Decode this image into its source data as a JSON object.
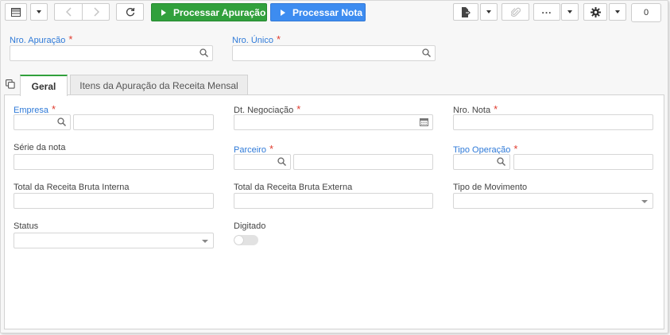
{
  "toolbar": {
    "process_apuracao_label": "Processar Apuração",
    "process_nota_label": "Processar Nota",
    "counter": "0",
    "colors": {
      "green": "#31a03c",
      "blue": "#3d8cf0"
    }
  },
  "header_fields": {
    "nro_apuracao": {
      "label": "Nro. Apuração",
      "required": "*",
      "value": ""
    },
    "nro_unico": {
      "label": "Nro. Único",
      "required": "*",
      "value": ""
    }
  },
  "tabs": [
    {
      "label": "Geral",
      "active": true
    },
    {
      "label": "Itens da Apuração da Receita Mensal",
      "active": false
    }
  ],
  "form": {
    "empresa": {
      "label": "Empresa",
      "required": "*"
    },
    "dt_negociacao": {
      "label": "Dt. Negociação",
      "required": "*"
    },
    "nro_nota": {
      "label": "Nro. Nota",
      "required": "*"
    },
    "serie_nota": {
      "label": "Série da nota"
    },
    "parceiro": {
      "label": "Parceiro",
      "required": "*"
    },
    "tipo_operacao": {
      "label": "Tipo Operação",
      "required": "*"
    },
    "total_interna": {
      "label": "Total da Receita Bruta Interna"
    },
    "total_externa": {
      "label": "Total da Receita Bruta Externa"
    },
    "tipo_movimento": {
      "label": "Tipo de Movimento"
    },
    "status": {
      "label": "Status"
    },
    "digitado": {
      "label": "Digitado",
      "checked": false
    }
  }
}
